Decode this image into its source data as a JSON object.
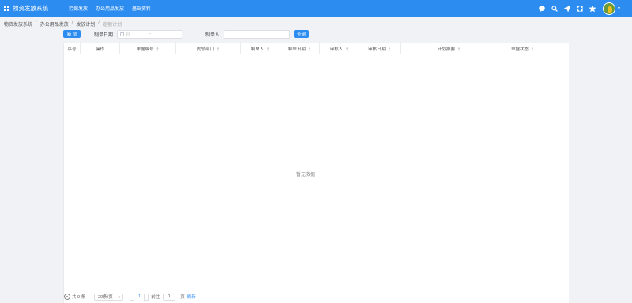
{
  "app": {
    "title": "物资发放系统"
  },
  "top_menu": [
    {
      "label": "劳保发放"
    },
    {
      "label": "办公用品发放"
    },
    {
      "label": "基础资料"
    }
  ],
  "top_icons": [
    "message-icon",
    "search-icon",
    "send-icon",
    "fullscreen-icon",
    "star-icon"
  ],
  "breadcrumb": [
    {
      "label": "物资发放系统"
    },
    {
      "label": "办公用品发放"
    },
    {
      "label": "发放计划"
    },
    {
      "label": "定额计划"
    }
  ],
  "filters": {
    "new_label": "新 增",
    "date_label": "制单日期",
    "date_placeholder": "日",
    "date_separator": "-",
    "maker_label": "制单人",
    "maker_value": "",
    "query_label": "查询"
  },
  "table": {
    "columns": [
      {
        "label": "序号",
        "sortable": false
      },
      {
        "label": "操作",
        "sortable": false
      },
      {
        "label": "单据编号",
        "sortable": true
      },
      {
        "label": "支领部门",
        "sortable": true
      },
      {
        "label": "制单人",
        "sortable": true
      },
      {
        "label": "制单日期",
        "sortable": true
      },
      {
        "label": "审核人",
        "sortable": true
      },
      {
        "label": "审核日期",
        "sortable": true
      },
      {
        "label": "计划摘要",
        "sortable": true
      },
      {
        "label": "单据状态",
        "sortable": true
      }
    ],
    "empty_text": "暂无数据"
  },
  "pagination": {
    "total_text": "共 0 条",
    "page_size": "20条/页",
    "current_page": "1",
    "goto_label": "前往",
    "goto_value": "1",
    "page_unit": "页",
    "refresh_label": "刷新"
  }
}
